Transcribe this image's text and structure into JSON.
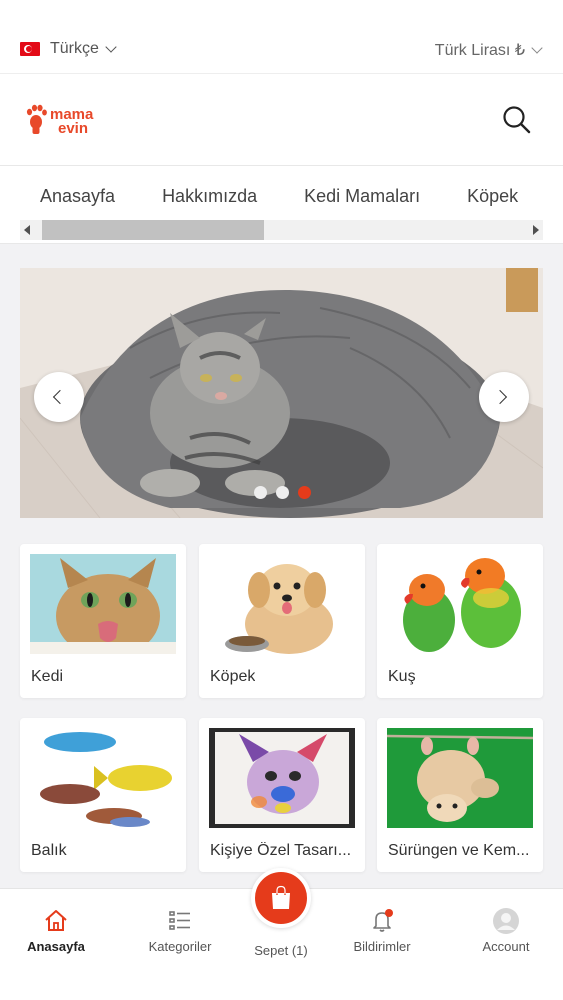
{
  "topbar": {
    "language": "Türkçe",
    "currency": "Türk Lirası ₺"
  },
  "header": {
    "logo_line1": "mama",
    "logo_line2": "evin"
  },
  "nav": {
    "items": [
      "Anasayfa",
      "Hakkımızda",
      "Kedi Mamaları",
      "Köpek"
    ]
  },
  "slider": {
    "dots": 3,
    "active_dot": 3
  },
  "categories": [
    {
      "label": "Kedi",
      "image": "cat-licking"
    },
    {
      "label": "Köpek",
      "image": "puppy-with-food-bowl"
    },
    {
      "label": "Kuş",
      "image": "lovebirds"
    },
    {
      "label": "Balık",
      "image": "tropical-fish"
    },
    {
      "label": "Kişiye Özel Tasarı...",
      "image": "bulldog-watercolor-art"
    },
    {
      "label": "Sürüngen ve Kem...",
      "image": "hamster-hanging"
    }
  ],
  "bottom_nav": {
    "home": "Anasayfa",
    "categories": "Kategoriler",
    "cart": "Sepet (1)",
    "notifications": "Bildirimler",
    "account": "Account"
  },
  "colors": {
    "accent": "#e53b1b"
  }
}
